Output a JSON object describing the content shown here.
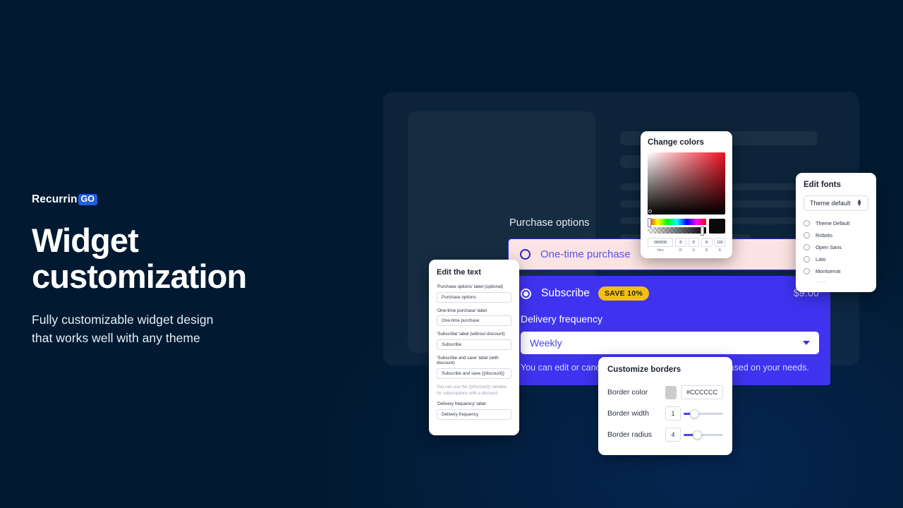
{
  "brand": {
    "word": "Recurrin",
    "badge": "GO"
  },
  "hero": {
    "title": "Widget\ncustomization",
    "subtitle": "Fully customizable widget design\nthat works well with any theme"
  },
  "widget": {
    "heading": "Purchase options",
    "one_time_label": "One-time purchase",
    "subscribe_label": "Subscribe",
    "save_badge": "SAVE 10%",
    "price": "$9.00",
    "frequency_label": "Delivery frequency",
    "frequency_value": "Weekly",
    "helper_text": "You can edit or cancel your subscription at any time based on your needs."
  },
  "panel_text": {
    "title": "Edit the text",
    "fields": [
      {
        "label": "'Purchase options' label (optional)",
        "value": "Purchase options"
      },
      {
        "label": "'One-time purchase' label",
        "value": "One-time purchase"
      },
      {
        "label": "'Subscribe' label (without discount)",
        "value": "Subscribe"
      },
      {
        "label": "'Subscribe and save' label (with discount)",
        "value": "Subscribe and save {{discount}}"
      }
    ],
    "hint": "You can use the {{discount}} variable for subscriptions with a discount",
    "last_label": "'Delivery frequency' label",
    "last_value": "Delivery frequency"
  },
  "panel_colors": {
    "title": "Change colors",
    "hex": "080808",
    "r": "8",
    "g": "8",
    "b": "8",
    "a": "100",
    "labels": {
      "hex": "Hex",
      "r": "R",
      "g": "G",
      "b": "B",
      "a": "A"
    }
  },
  "panel_fonts": {
    "title": "Edit fonts",
    "selected": "Theme default",
    "options": [
      "Theme Default",
      "Roboto",
      "Open Sans",
      "Lato",
      "Montserrat"
    ],
    "more": "......"
  },
  "panel_borders": {
    "title": "Customize borders",
    "color_label": "Border color",
    "color_value": "#CCCCCC",
    "width_label": "Border width",
    "width_value": "1",
    "radius_label": "Border radius",
    "radius_value": "4"
  },
  "colors": {
    "accent_blue": "#3f33f0",
    "badge_yellow": "#f2c013",
    "one_time_bg": "#fbe3e3",
    "brand_badge": "#1f5fe0",
    "bg_navy": "#021a31"
  }
}
